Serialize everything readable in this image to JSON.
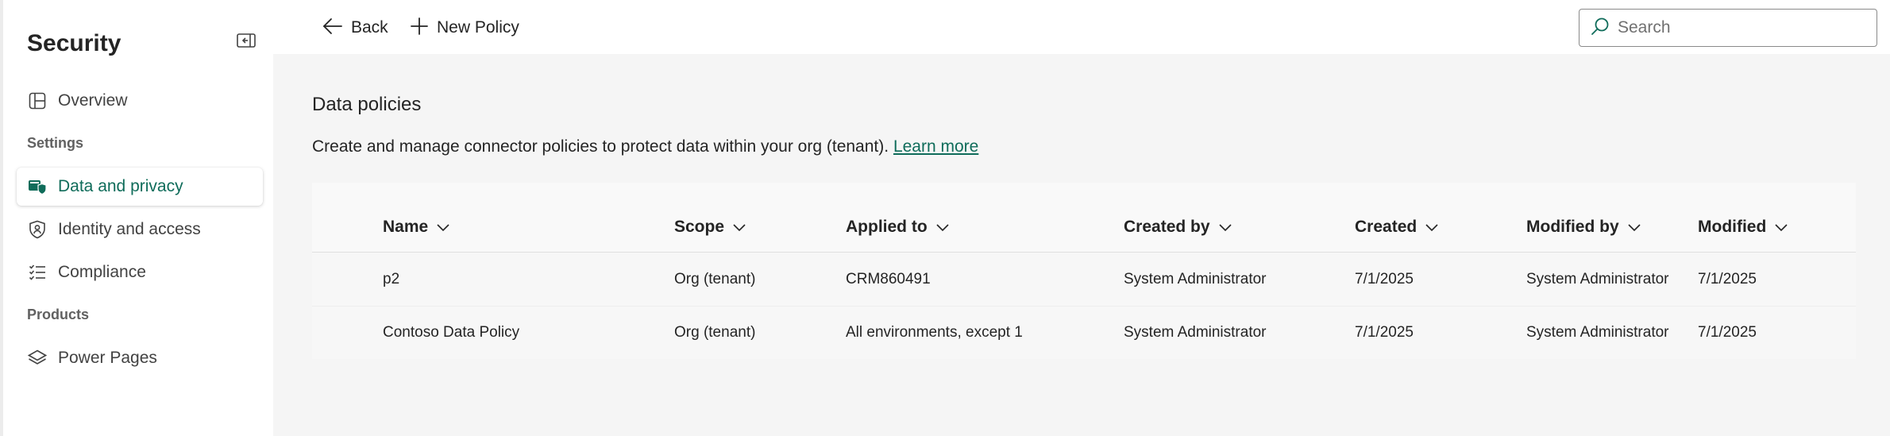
{
  "sidebar": {
    "title": "Security",
    "items": [
      {
        "label": "Overview",
        "icon": "overview-icon"
      },
      {
        "label": "Data and privacy",
        "icon": "data-privacy-icon",
        "active": true
      },
      {
        "label": "Identity and access",
        "icon": "shield-icon"
      },
      {
        "label": "Compliance",
        "icon": "checklist-icon"
      },
      {
        "label": "Power Pages",
        "icon": "power-pages-icon"
      }
    ],
    "sections": {
      "settings": "Settings",
      "products": "Products"
    }
  },
  "toolbar": {
    "back_label": "Back",
    "new_policy_label": "New Policy",
    "search_placeholder": "Search"
  },
  "main": {
    "title": "Data policies",
    "description": "Create and manage connector policies to protect data within your org (tenant).",
    "learn_more": "Learn more"
  },
  "table": {
    "columns": [
      "Name",
      "Scope",
      "Applied to",
      "Created by",
      "Created",
      "Modified by",
      "Modified"
    ],
    "rows": [
      {
        "name": "p2",
        "scope": "Org (tenant)",
        "applied_to": "CRM860491",
        "created_by": "System Administrator",
        "created": "7/1/2025",
        "modified_by": "System Administrator",
        "modified": "7/1/2025"
      },
      {
        "name": "Contoso Data Policy",
        "scope": "Org (tenant)",
        "applied_to": "All environments, except 1",
        "created_by": "System Administrator",
        "created": "7/1/2025",
        "modified_by": "System Administrator",
        "modified": "7/1/2025"
      }
    ]
  },
  "colors": {
    "accent": "#0f6c5a",
    "sidebar_bg": "#ffffff",
    "main_bg": "#f5f5f5"
  }
}
